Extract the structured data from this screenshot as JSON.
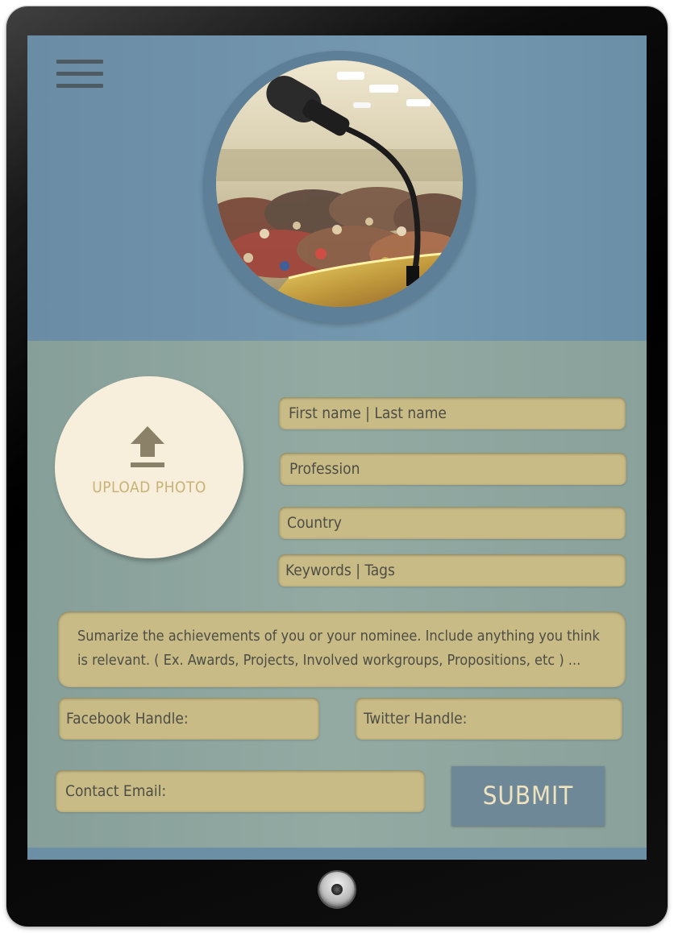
{
  "header": {
    "menu_icon": "hamburger-menu-icon",
    "profile_image": "microphone-audience-photo"
  },
  "upload": {
    "icon": "upload-arrow-icon",
    "label": "UPLOAD PHOTO"
  },
  "fields": {
    "name": "First name | Last name",
    "profession": "Profession",
    "country": "Country",
    "keywords": "Keywords | Tags",
    "summary": "Sumarize the achievements of you or your nominee. Include anything you think is relevant. ( Ex. Awards, Projects, Involved workgroups, Propositions, etc ) ...",
    "facebook": "Facebook Handle:",
    "twitter": "Twitter Handle:",
    "email": "Contact Email:"
  },
  "submit_label": "SUBMIT",
  "colors": {
    "header_bg": "#7094ac",
    "form_bg": "#8fa69f",
    "field_bg": "#c8bb86",
    "upload_circle": "#f7efdb",
    "submit_bg": "#6f8898"
  }
}
